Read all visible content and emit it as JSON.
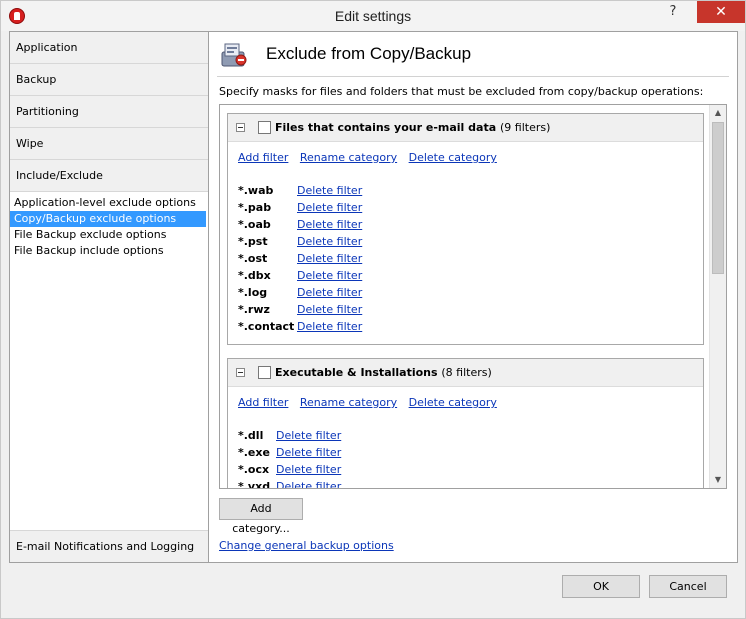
{
  "window": {
    "title": "Edit settings",
    "help": "?",
    "close": "✕"
  },
  "nav": {
    "items": [
      "Application",
      "Backup",
      "Partitioning",
      "Wipe",
      "Include/Exclude"
    ],
    "sub_items": [
      "Application-level exclude options",
      "Copy/Backup exclude options",
      "File Backup exclude options",
      "File Backup include options"
    ],
    "selected_sub": 1,
    "bottom": "E-mail Notifications and Logging"
  },
  "page": {
    "title": "Exclude from Copy/Backup",
    "description": "Specify masks for files and folders that must be excluded from copy/backup operations:"
  },
  "actions": {
    "add_filter": "Add filter",
    "rename_category": "Rename category",
    "delete_category": "Delete category",
    "delete_filter": "Delete filter"
  },
  "categories": [
    {
      "name": "Files that contains your e-mail data",
      "count": "(9 filters)",
      "filters": [
        "*.wab",
        "*.pab",
        "*.oab",
        "*.pst",
        "*.ost",
        "*.dbx",
        "*.log",
        "*.rwz",
        "*.contact"
      ]
    },
    {
      "name": "Executable & Installations",
      "count": "(8 filters)",
      "filters": [
        "*.dll",
        "*.exe",
        "*.ocx",
        "*.vxd"
      ]
    }
  ],
  "buttons": {
    "add_category": "Add category...",
    "change_general": "Change general backup options",
    "ok": "OK",
    "cancel": "Cancel"
  },
  "colors": {
    "link": "#0b36b8",
    "selection": "#3399ff",
    "close": "#c7352b"
  }
}
